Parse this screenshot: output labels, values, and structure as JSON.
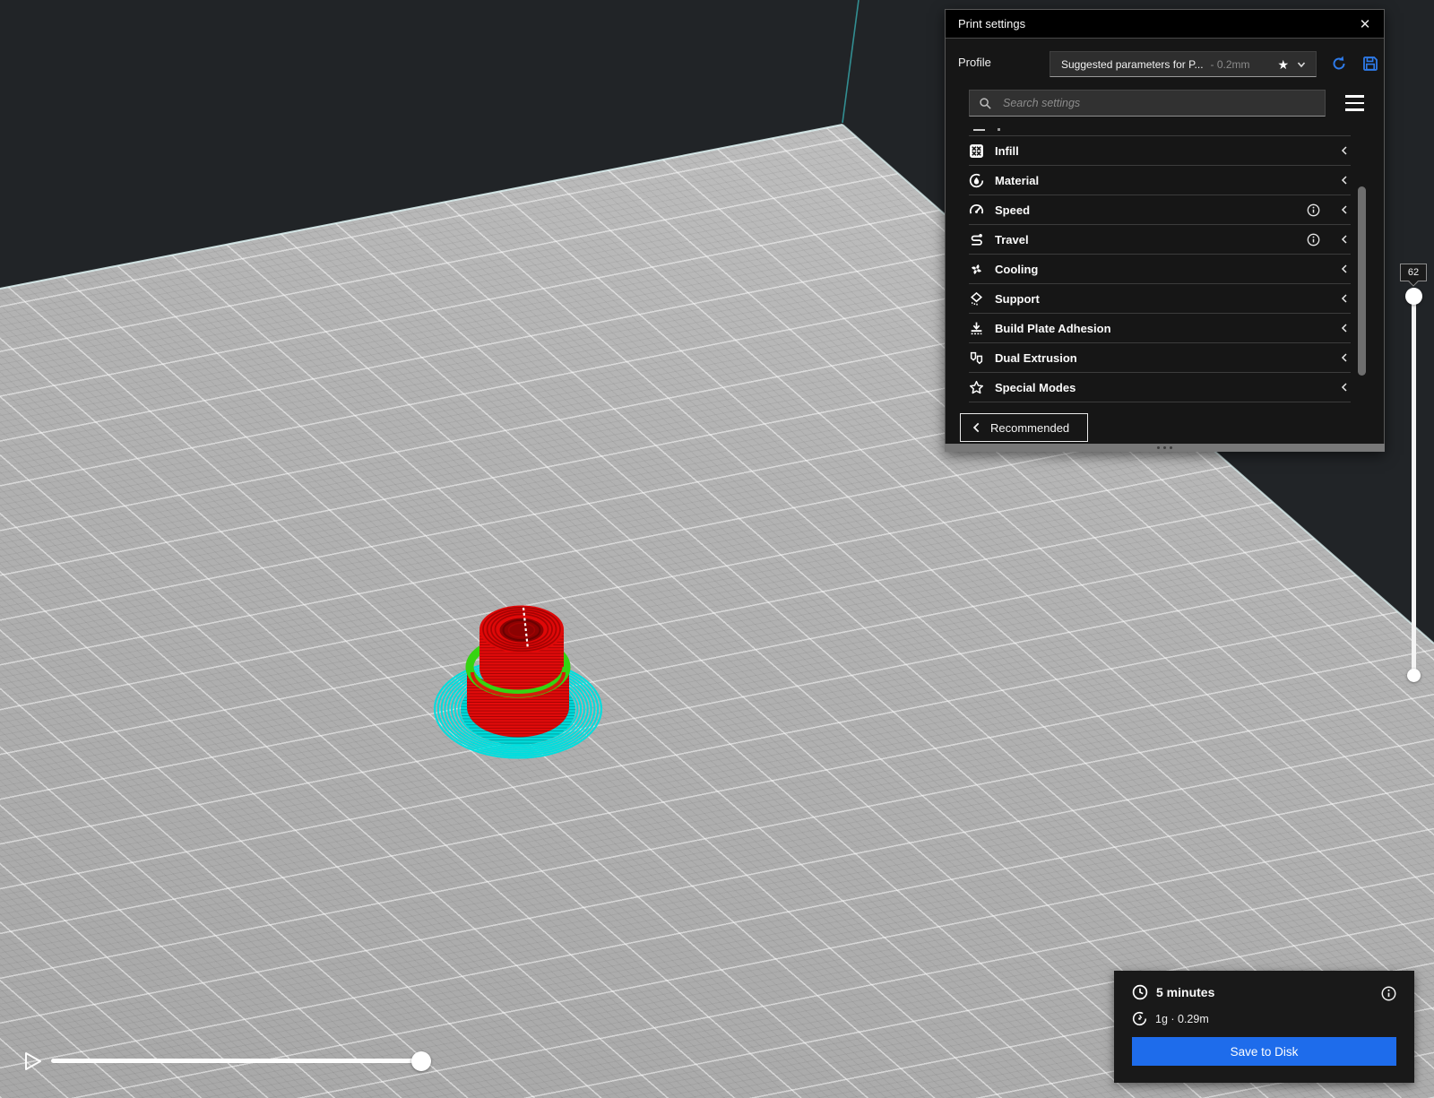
{
  "colors": {
    "accent_blue": "#1e6ceb",
    "model_red": "#e30b0b",
    "brim_cyan": "#00dede",
    "infill_green": "#35d411",
    "plate_gray": "#b3b3b3",
    "background_dark": "#212427"
  },
  "print_settings": {
    "title": "Print settings",
    "close_icon": "✕",
    "profile": {
      "label": "Profile",
      "value": "Suggested parameters for P...",
      "variant": "- 0.2mm"
    },
    "search": {
      "placeholder": "Search settings"
    },
    "categories": [
      {
        "label": "Infill",
        "icon": "infill-icon",
        "info": false
      },
      {
        "label": "Material",
        "icon": "material-icon",
        "info": false
      },
      {
        "label": "Speed",
        "icon": "speed-icon",
        "info": true
      },
      {
        "label": "Travel",
        "icon": "travel-icon",
        "info": true
      },
      {
        "label": "Cooling",
        "icon": "cooling-icon",
        "info": false
      },
      {
        "label": "Support",
        "icon": "support-icon",
        "info": false
      },
      {
        "label": "Build Plate Adhesion",
        "icon": "adhesion-icon",
        "info": false
      },
      {
        "label": "Dual Extrusion",
        "icon": "dual-extrusion-icon",
        "info": false
      },
      {
        "label": "Special Modes",
        "icon": "special-modes-icon",
        "info": false
      }
    ],
    "recommended_label": "Recommended"
  },
  "layer_slider": {
    "current_layer": "62"
  },
  "print_summary": {
    "time": "5 minutes",
    "material_usage": "1g · 0.29m",
    "save_button": "Save to Disk"
  }
}
